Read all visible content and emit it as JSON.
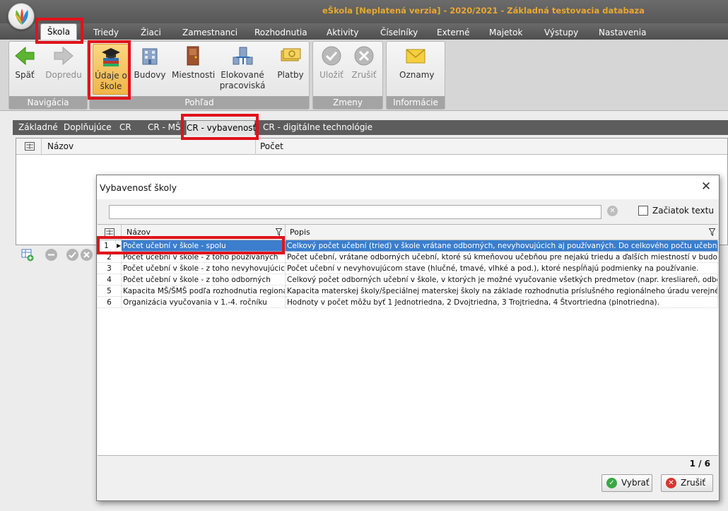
{
  "window": {
    "title": "eŠkola [Neplatená verzia] - 2020/2021 - Základná testovacia databaza"
  },
  "menu": {
    "tabs": [
      "Škola",
      "Triedy",
      "Žiaci",
      "Zamestnanci",
      "Rozhodnutia",
      "Aktivity",
      "Číselníky",
      "Externé",
      "Majetok",
      "Výstupy",
      "Nastavenia"
    ],
    "active": "Škola"
  },
  "ribbon": {
    "groups": {
      "navigacia": "Navigácia",
      "pohlad": "Pohľad",
      "zmeny": "Zmeny",
      "informacie": "Informácie"
    },
    "buttons": {
      "spat": "Späť",
      "dopredu": "Dopredu",
      "udaje_1": "Údaje o",
      "udaje_2": "škole",
      "budovy": "Budovy",
      "miestnosti": "Miestnosti",
      "elokovane_1": "Elokované",
      "elokovane_2": "pracoviská",
      "platby": "Platby",
      "ulozit": "Uložiť",
      "zrusit": "Zrušiť",
      "oznamy": "Oznamy"
    }
  },
  "subtabs": [
    "Základné",
    "Doplňujúce",
    "CR",
    "CR - MŠ",
    "CR - vybavenosť",
    "CR - digitálne technológie"
  ],
  "background_grid": {
    "col_name": "Názov",
    "col_count": "Počet"
  },
  "dialog": {
    "title": "Vybavenosť školy",
    "close": "✕",
    "search": {
      "value": "",
      "placeholder": ""
    },
    "checkbox_label": "Začiatok textu",
    "columns": {
      "name": "Názov",
      "desc": "Popis"
    },
    "rows": [
      {
        "num": "1",
        "name": "Počet učební v škole - spolu",
        "desc": "Celkový počet učební (tried) v škole vrátane odborných, nevyhovujúcich aj používaných. Do celkového počtu učební sa neza..."
      },
      {
        "num": "2",
        "name": "Počet učební v škole - z toho používaných",
        "desc": "Počet učební, vrátane odborných učební, ktoré sú kmeňovou učebňou pre nejakú triedu a ďalších miestností v budove školy ..."
      },
      {
        "num": "3",
        "name": "Počet učební v škole - z toho nevyhovujúcich",
        "desc": "Počet učební v nevyhovujúcom stave (hlučné, tmavé, vlhké a pod.), ktoré nespĺňajú podmienky na používanie."
      },
      {
        "num": "4",
        "name": "Počet učební v škole - z toho odborných",
        "desc": "Celkový počet odborných učební v škole, v ktorých je možné vyučovanie všetkých predmetov (napr. kresliareň, odborná učeb..."
      },
      {
        "num": "5",
        "name": "Kapacita MŠ/ŠMŠ podľa rozhodnutia regionál...",
        "desc": "Kapacita materskej školy/špeciálnej materskej školy na základe rozhodnutia príslušného regionálneho úradu verejného zdravot..."
      },
      {
        "num": "6",
        "name": "Organizácia vyučovania v 1.-4. ročníku",
        "desc": "Hodnoty v počet môžu byť 1 Jednotriedna, 2 Dvojtriedna, 3 Trojtriedna, 4 Štvortriedna (plnotriedna)."
      }
    ],
    "counter": "1 / 6",
    "ok_label": "Vybrať",
    "cancel_label": "Zrušiť"
  },
  "colors": {
    "title_accent": "#e9a92e",
    "highlight": "#e0131b",
    "selection": "#3a7ecd"
  }
}
